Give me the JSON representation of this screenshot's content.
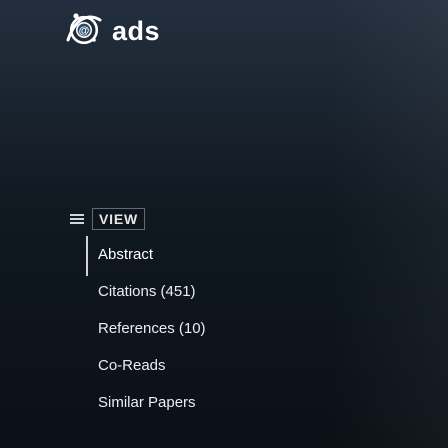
{
  "brand": {
    "name": "ads",
    "logo_icon": "ads-logo-icon"
  },
  "view_section": {
    "heading": "VIEW",
    "icon": "list-icon"
  },
  "nav": {
    "items": [
      {
        "label": "Abstract",
        "active": true
      },
      {
        "label": "Citations (451)"
      },
      {
        "label": "References (10)"
      },
      {
        "label": "Co-Reads"
      },
      {
        "label": "Similar Papers"
      }
    ]
  }
}
